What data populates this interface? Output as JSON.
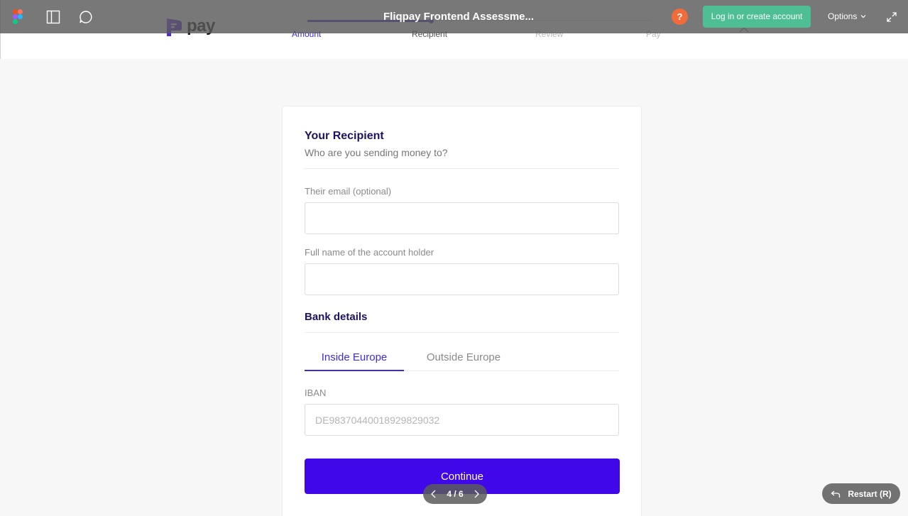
{
  "colors": {
    "primary": "#4007e8",
    "accent_purple": "#3c2cd4",
    "heading": "#1f1264",
    "figma_bar": "#5a5a5a",
    "login_green": "#4ebf94",
    "help_orange": "#f26b3a"
  },
  "figma_bar": {
    "title": "Fliqpay Frontend Assessme...",
    "help_label": "?",
    "login_label": "Log in or create account",
    "options_label": "Options",
    "icons": [
      "figma-logo-icon",
      "sidebar-panel-icon",
      "comment-icon",
      "chevron-down-icon",
      "expand-icon"
    ]
  },
  "app": {
    "logo_text": "pay",
    "steps": [
      {
        "label": "Amount",
        "state": "active"
      },
      {
        "label": "Recipient",
        "state": "current"
      },
      {
        "label": "Review",
        "state": "upcoming"
      },
      {
        "label": "Pay",
        "state": "upcoming"
      }
    ],
    "progress_fraction": 0.36
  },
  "card": {
    "title": "Your Recipient",
    "subtitle": "Who are you sending money to?",
    "email_label": "Their email (optional)",
    "email_value": "",
    "name_label": "Full name of the account holder",
    "name_value": "",
    "bank_title": "Bank details",
    "tabs": [
      {
        "label": "Inside Europe",
        "active": true
      },
      {
        "label": "Outside Europe",
        "active": false
      }
    ],
    "iban_label": "IBAN",
    "iban_placeholder": "DE98370440018929829032",
    "continue_label": "Continue"
  },
  "pager": {
    "count": "4 / 6"
  },
  "restart": {
    "label": "Restart (R)"
  }
}
